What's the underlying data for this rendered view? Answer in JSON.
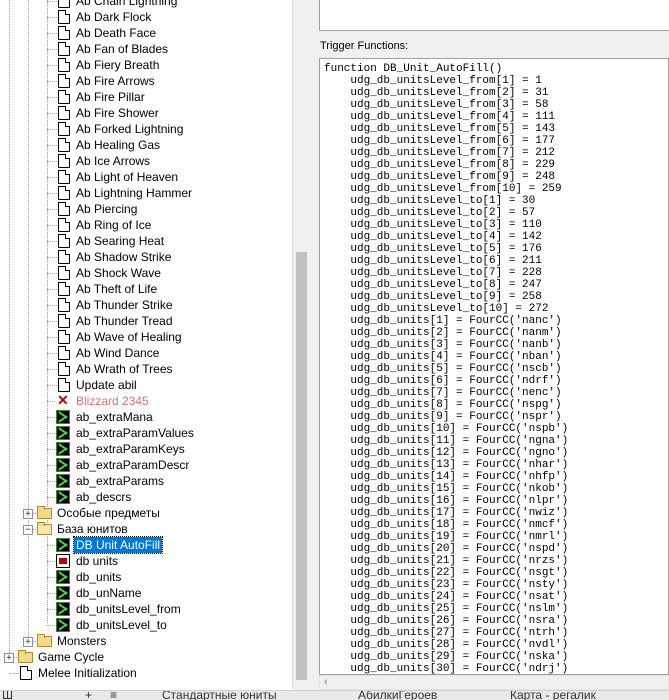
{
  "tree": {
    "items": [
      {
        "label": "Ab Chain Lightning",
        "icon": "page",
        "level": 3
      },
      {
        "label": "Ab Dark Flock",
        "icon": "page",
        "level": 3
      },
      {
        "label": "Ab Death Face",
        "icon": "page",
        "level": 3
      },
      {
        "label": "Ab Fan of Blades",
        "icon": "page",
        "level": 3
      },
      {
        "label": "Ab Fiery Breath",
        "icon": "page",
        "level": 3
      },
      {
        "label": "Ab Fire Arrows",
        "icon": "page",
        "level": 3
      },
      {
        "label": "Ab Fire Pillar",
        "icon": "page",
        "level": 3
      },
      {
        "label": "Ab Fire Shower",
        "icon": "page",
        "level": 3
      },
      {
        "label": "Ab Forked Lightning",
        "icon": "page",
        "level": 3
      },
      {
        "label": "Ab Healing Gas",
        "icon": "page",
        "level": 3
      },
      {
        "label": "Ab Ice Arrows",
        "icon": "page",
        "level": 3
      },
      {
        "label": "Ab Light of Heaven",
        "icon": "page",
        "level": 3
      },
      {
        "label": "Ab Lightning Hammer",
        "icon": "page",
        "level": 3
      },
      {
        "label": "Ab Piercing",
        "icon": "page",
        "level": 3
      },
      {
        "label": "Ab Ring of Ice",
        "icon": "page",
        "level": 3
      },
      {
        "label": "Ab Searing Heat",
        "icon": "page",
        "level": 3
      },
      {
        "label": "Ab Shadow Strike",
        "icon": "page",
        "level": 3
      },
      {
        "label": "Ab Shock Wave",
        "icon": "page",
        "level": 3
      },
      {
        "label": "Ab Theft of Life",
        "icon": "page",
        "level": 3
      },
      {
        "label": "Ab Thunder Strike",
        "icon": "page",
        "level": 3
      },
      {
        "label": "Ab Thunder Tread",
        "icon": "page",
        "level": 3
      },
      {
        "label": "Ab Wave of Healing",
        "icon": "page",
        "level": 3
      },
      {
        "label": "Ab Wind Dance",
        "icon": "page",
        "level": 3
      },
      {
        "label": "Ab Wrath of Trees",
        "icon": "page",
        "level": 3
      },
      {
        "label": "Update abil",
        "icon": "page",
        "level": 3
      },
      {
        "label": "Blizzard 2345",
        "icon": "disabled",
        "level": 3,
        "disabled": true
      },
      {
        "label": "ab_extraMana",
        "icon": "script",
        "level": 3
      },
      {
        "label": "ab_extraParamValues",
        "icon": "script",
        "level": 3
      },
      {
        "label": "ab_extraParamKeys",
        "icon": "script",
        "level": 3
      },
      {
        "label": "ab_extraParamDescr",
        "icon": "script",
        "level": 3
      },
      {
        "label": "ab_extraParams",
        "icon": "script",
        "level": 3
      },
      {
        "label": "ab_descrs",
        "icon": "script",
        "level": 3
      },
      {
        "label": "Особые предметы",
        "icon": "folder",
        "level": 2,
        "expander": "+"
      },
      {
        "label": "База юнитов",
        "icon": "folder-open",
        "level": 2,
        "expander": "−"
      },
      {
        "label": "DB Unit AutoFill",
        "icon": "script",
        "level": 3,
        "selected": true
      },
      {
        "label": "db units",
        "icon": "wide",
        "level": 3
      },
      {
        "label": "db_units",
        "icon": "script",
        "level": 3
      },
      {
        "label": "db_unName",
        "icon": "script",
        "level": 3
      },
      {
        "label": "db_unitsLevel_from",
        "icon": "script",
        "level": 3
      },
      {
        "label": "db_unitsLevel_to",
        "icon": "script",
        "level": 3
      },
      {
        "label": "Monsters",
        "icon": "folder",
        "level": 2,
        "expander": "+"
      },
      {
        "label": "Game Cycle",
        "icon": "folder",
        "level": 1,
        "expander": "+"
      },
      {
        "label": "Melee Initialization",
        "icon": "page",
        "level": 1
      }
    ]
  },
  "editor": {
    "section_label": "Trigger Functions:",
    "code_lines": [
      "function DB_Unit_AutoFill()",
      "    udg_db_unitsLevel_from[1] = 1",
      "    udg_db_unitsLevel_from[2] = 31",
      "    udg_db_unitsLevel_from[3] = 58",
      "    udg_db_unitsLevel_from[4] = 111",
      "    udg_db_unitsLevel_from[5] = 143",
      "    udg_db_unitsLevel_from[6] = 177",
      "    udg_db_unitsLevel_from[7] = 212",
      "    udg_db_unitsLevel_from[8] = 229",
      "    udg_db_unitsLevel_from[9] = 248",
      "    udg_db_unitsLevel_from[10] = 259",
      "    udg_db_unitsLevel_to[1] = 30",
      "    udg_db_unitsLevel_to[2] = 57",
      "    udg_db_unitsLevel_to[3] = 110",
      "    udg_db_unitsLevel_to[4] = 142",
      "    udg_db_unitsLevel_to[5] = 176",
      "    udg_db_unitsLevel_to[6] = 211",
      "    udg_db_unitsLevel_to[7] = 228",
      "    udg_db_unitsLevel_to[8] = 247",
      "    udg_db_unitsLevel_to[9] = 258",
      "    udg_db_unitsLevel_to[10] = 272",
      "    udg_db_units[1] = FourCC('nanc')",
      "    udg_db_units[2] = FourCC('nanm')",
      "    udg_db_units[3] = FourCC('nanb')",
      "    udg_db_units[4] = FourCC('nban')",
      "    udg_db_units[5] = FourCC('nscb')",
      "    udg_db_units[6] = FourCC('ndrf')",
      "    udg_db_units[7] = FourCC('nenc')",
      "    udg_db_units[8] = FourCC('nspg')",
      "    udg_db_units[9] = FourCC('nspr')",
      "    udg_db_units[10] = FourCC('nspb')",
      "    udg_db_units[11] = FourCC('ngna')",
      "    udg_db_units[12] = FourCC('ngno')",
      "    udg_db_units[13] = FourCC('nhar')",
      "    udg_db_units[14] = FourCC('nhfp')",
      "    udg_db_units[15] = FourCC('nkob')",
      "    udg_db_units[16] = FourCC('nlpr')",
      "    udg_db_units[17] = FourCC('nwiz')",
      "    udg_db_units[18] = FourCC('nmcf')",
      "    udg_db_units[19] = FourCC('nmrl')",
      "    udg_db_units[20] = FourCC('nspd')",
      "    udg_db_units[21] = FourCC('nrzs')",
      "    udg_db_units[22] = FourCC('nsgt')",
      "    udg_db_units[23] = FourCC('nsty')",
      "    udg_db_units[24] = FourCC('nsat')",
      "    udg_db_units[25] = FourCC('nslm')",
      "    udg_db_units[26] = FourCC('nsra')",
      "    udg_db_units[27] = FourCC('ntrh')",
      "    udg_db_units[28] = FourCC('nvdl')",
      "    udg_db_units[29] = FourCC('nska')",
      "    udg_db_units[30] = FourCC('ndrj')"
    ],
    "hscroll_left_icon": "chevron-left-icon"
  },
  "bottom_bar": {
    "segments": [
      "Ш",
      "+",
      "≡",
      "Стандартные юниты",
      "АбилкиГероев",
      "Карта - регалик"
    ]
  }
}
